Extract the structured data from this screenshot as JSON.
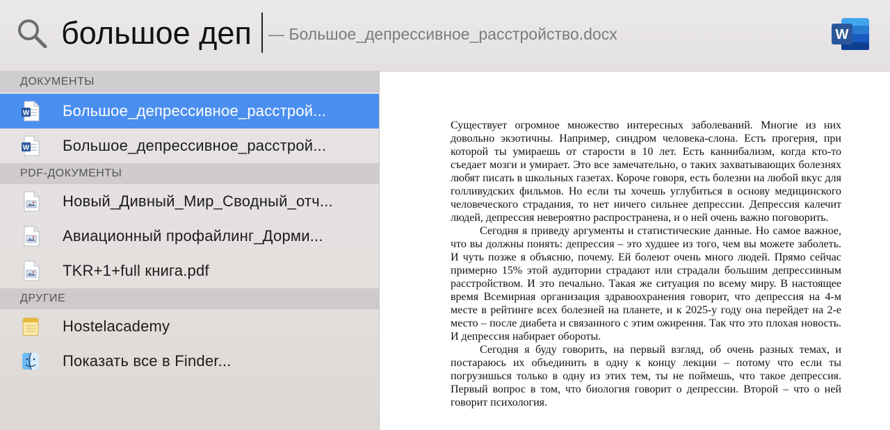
{
  "search": {
    "query": "большое деп",
    "completion": "— Большое_депрессивное_расстройство.docx"
  },
  "icons": {
    "search": "search-icon",
    "word_app": "microsoft-word-icon",
    "word_doc": "word-document-icon",
    "pdf_doc": "pdf-document-icon",
    "note": "notes-icon",
    "finder": "finder-icon"
  },
  "colors": {
    "selection": "#4a8ff0",
    "word_blue": "#2b579a"
  },
  "sidebar": {
    "sections": [
      {
        "header": "ДОКУМЕНТЫ",
        "items": [
          {
            "label": "Большое_депрессивное_расстрой...",
            "icon": "word-document-icon",
            "selected": true
          },
          {
            "label": "Большое_депрессивное_расстрой...",
            "icon": "word-document-icon",
            "selected": false
          }
        ]
      },
      {
        "header": "PDF-ДОКУМЕНТЫ",
        "items": [
          {
            "label": "Новый_Дивный_Мир_Сводный_отч...",
            "icon": "pdf-document-icon"
          },
          {
            "label": "Авиационный профайлинг_Дорми...",
            "icon": "pdf-document-icon"
          },
          {
            "label": "TKR+1+full книга.pdf",
            "icon": "pdf-document-icon"
          }
        ]
      },
      {
        "header": "ДРУГИЕ",
        "items": [
          {
            "label": "Hostelacademy",
            "icon": "notes-icon"
          },
          {
            "label": "Показать все в Finder...",
            "icon": "finder-icon"
          }
        ]
      }
    ]
  },
  "preview": {
    "paragraphs": [
      "Существует огромное множество интересных заболеваний. Многие из них довольно экзотичны. Например, синдром человека-слона. Есть прогерия, при которой ты умираешь от старости в 10 лет. Есть каннибализм, когда кто-то съедает мозги и умирает. Это все замечательно, о таких захватывающих болезнях любят писать в школьных газетах. Короче говоря, есть болезни на любой вкус для голливудских фильмов. Но если ты хочешь углубиться в основу медицинского человеческого страдания, то нет ничего сильнее депрессии. Депрессия калечит людей, депрессия невероятно распространена, и о ней очень важно поговорить.",
      "Сегодня я приведу аргументы и статистические данные. Но самое важное, что вы должны понять: депрессия – это худшее из того, чем вы можете заболеть. И чуть позже я объясню, почему. Ей болеют очень много людей. Прямо сейчас примерно 15% этой аудитории страдают или страдали большим депрессивным расстройством. И это печально. Такая же ситуация по всему миру. В настоящее время Всемирная организация здравоохранения говорит, что депрессия на 4-м месте в рейтинге всех болезней на планете, и к 2025-у году она перейдет на 2-е место – после диабета и связанного с этим ожирения. Так что это плохая новость. И депрессия набирает обороты.",
      "Сегодня я буду говорить, на первый взгляд, об очень разных темах, и постараюсь их объединить в одну к концу лекции – потому что если ты погрузишься только в одну из этих тем, ты не поймешь, что такое депрессия. Первый вопрос в том, что биология говорит о депрессии. Второй – что о ней говорит психология."
    ]
  }
}
